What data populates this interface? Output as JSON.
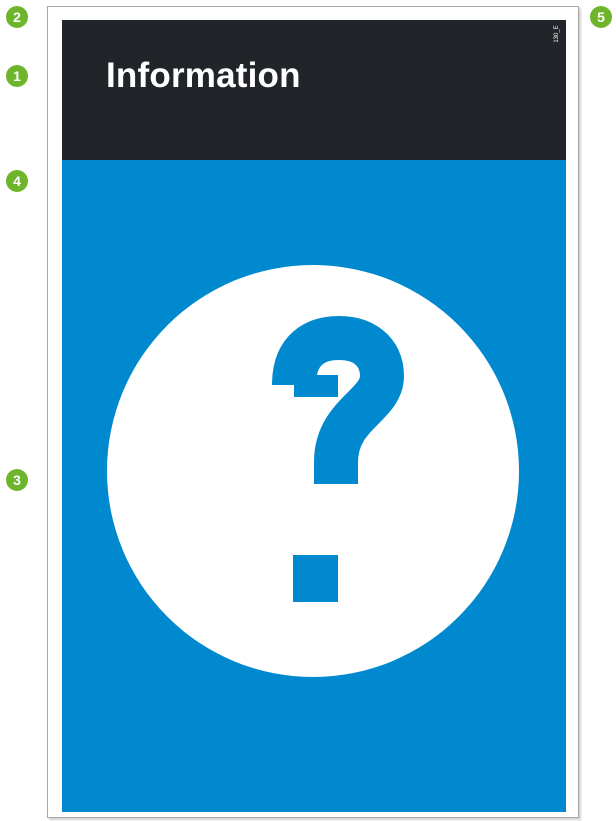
{
  "sign": {
    "title": "Information",
    "code": "130_E",
    "colors": {
      "header": "#212529",
      "panel": "#0089cf",
      "symbol_circle": "#ffffff",
      "symbol_mark": "#0089cf",
      "marker": "#6fb52c"
    },
    "symbol_icon": "question-mark-icon"
  },
  "markers": {
    "m1": "1",
    "m2": "2",
    "m3": "3",
    "m4": "4",
    "m5": "5"
  }
}
